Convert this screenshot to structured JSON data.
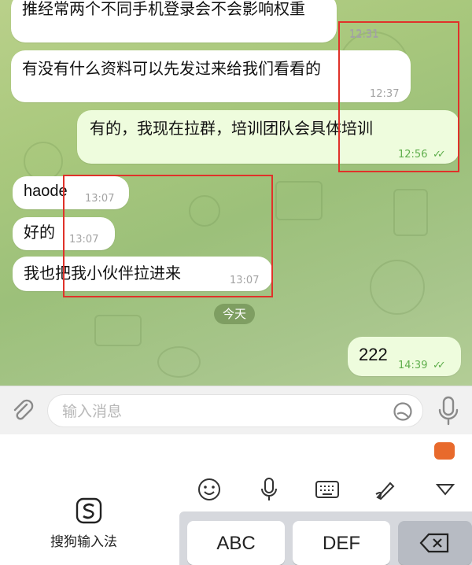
{
  "messages": [
    {
      "text": "推经常两个不同手机登录会不会影响权重",
      "time": "12:31",
      "direction": "in"
    },
    {
      "text": "有没有什么资料可以先发过来给我们看看的",
      "time": "12:37",
      "direction": "in"
    },
    {
      "text": "有的，我现在拉群，培训团队会具体培训",
      "time": "12:56",
      "direction": "out",
      "read": true
    },
    {
      "text": "haode",
      "time": "13:07",
      "direction": "in"
    },
    {
      "text": "好的",
      "time": "13:07",
      "direction": "in"
    },
    {
      "text": "我也把我小伙伴拉进来",
      "time": "13:07",
      "direction": "in"
    },
    {
      "text": "222",
      "time": "14:39",
      "direction": "out",
      "read": true
    }
  ],
  "date_divider": "今天",
  "input": {
    "placeholder": "输入消息",
    "value": ""
  },
  "keyboard": {
    "ime_name": "搜狗输入法",
    "keys": [
      "ABC",
      "DEF"
    ],
    "toolbar_icons": [
      "emoji-icon",
      "voice-icon",
      "keyboard-icon",
      "handwriting-icon",
      "collapse-icon"
    ]
  },
  "icons": {
    "attach": "paperclip-icon",
    "sticker": "sticker-icon",
    "mic": "microphone-icon",
    "delete": "backspace-icon"
  },
  "colors": {
    "chat_background": "#a9c87d",
    "incoming_bubble": "#ffffff",
    "outgoing_bubble": "#eefcdd",
    "outgoing_time": "#5fae4c",
    "highlight_box": "#e0322a"
  }
}
